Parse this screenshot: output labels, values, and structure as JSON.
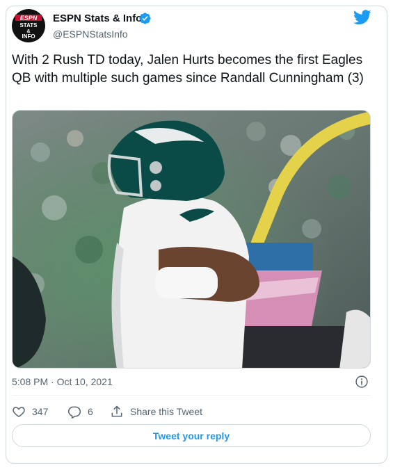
{
  "author": {
    "display_name": "ESPN Stats & Info",
    "handle": "@ESPNStatsInfo",
    "verified": true,
    "avatar_icon": "espn-stats-info-logo",
    "avatar_text": [
      "ESPN",
      "STATS",
      "&",
      "INFO"
    ]
  },
  "platform_icon": "twitter-bird-icon",
  "tweet": {
    "text": "With 2 Rush TD today, Jalen Hurts becomes the first Eagles QB with multiple such games since Randall Cunningham (3)",
    "media_alt": "football player photo"
  },
  "meta": {
    "timestamp": "5:08 PM · Oct 10, 2021"
  },
  "actions": {
    "like_count": "347",
    "reply_count": "6",
    "share_label": "Share this Tweet"
  },
  "reply_button_label": "Tweet your reply",
  "colors": {
    "accent": "#1d9bf0",
    "text_primary": "#0f1419",
    "text_secondary": "#536471",
    "border": "#cfd9de"
  }
}
